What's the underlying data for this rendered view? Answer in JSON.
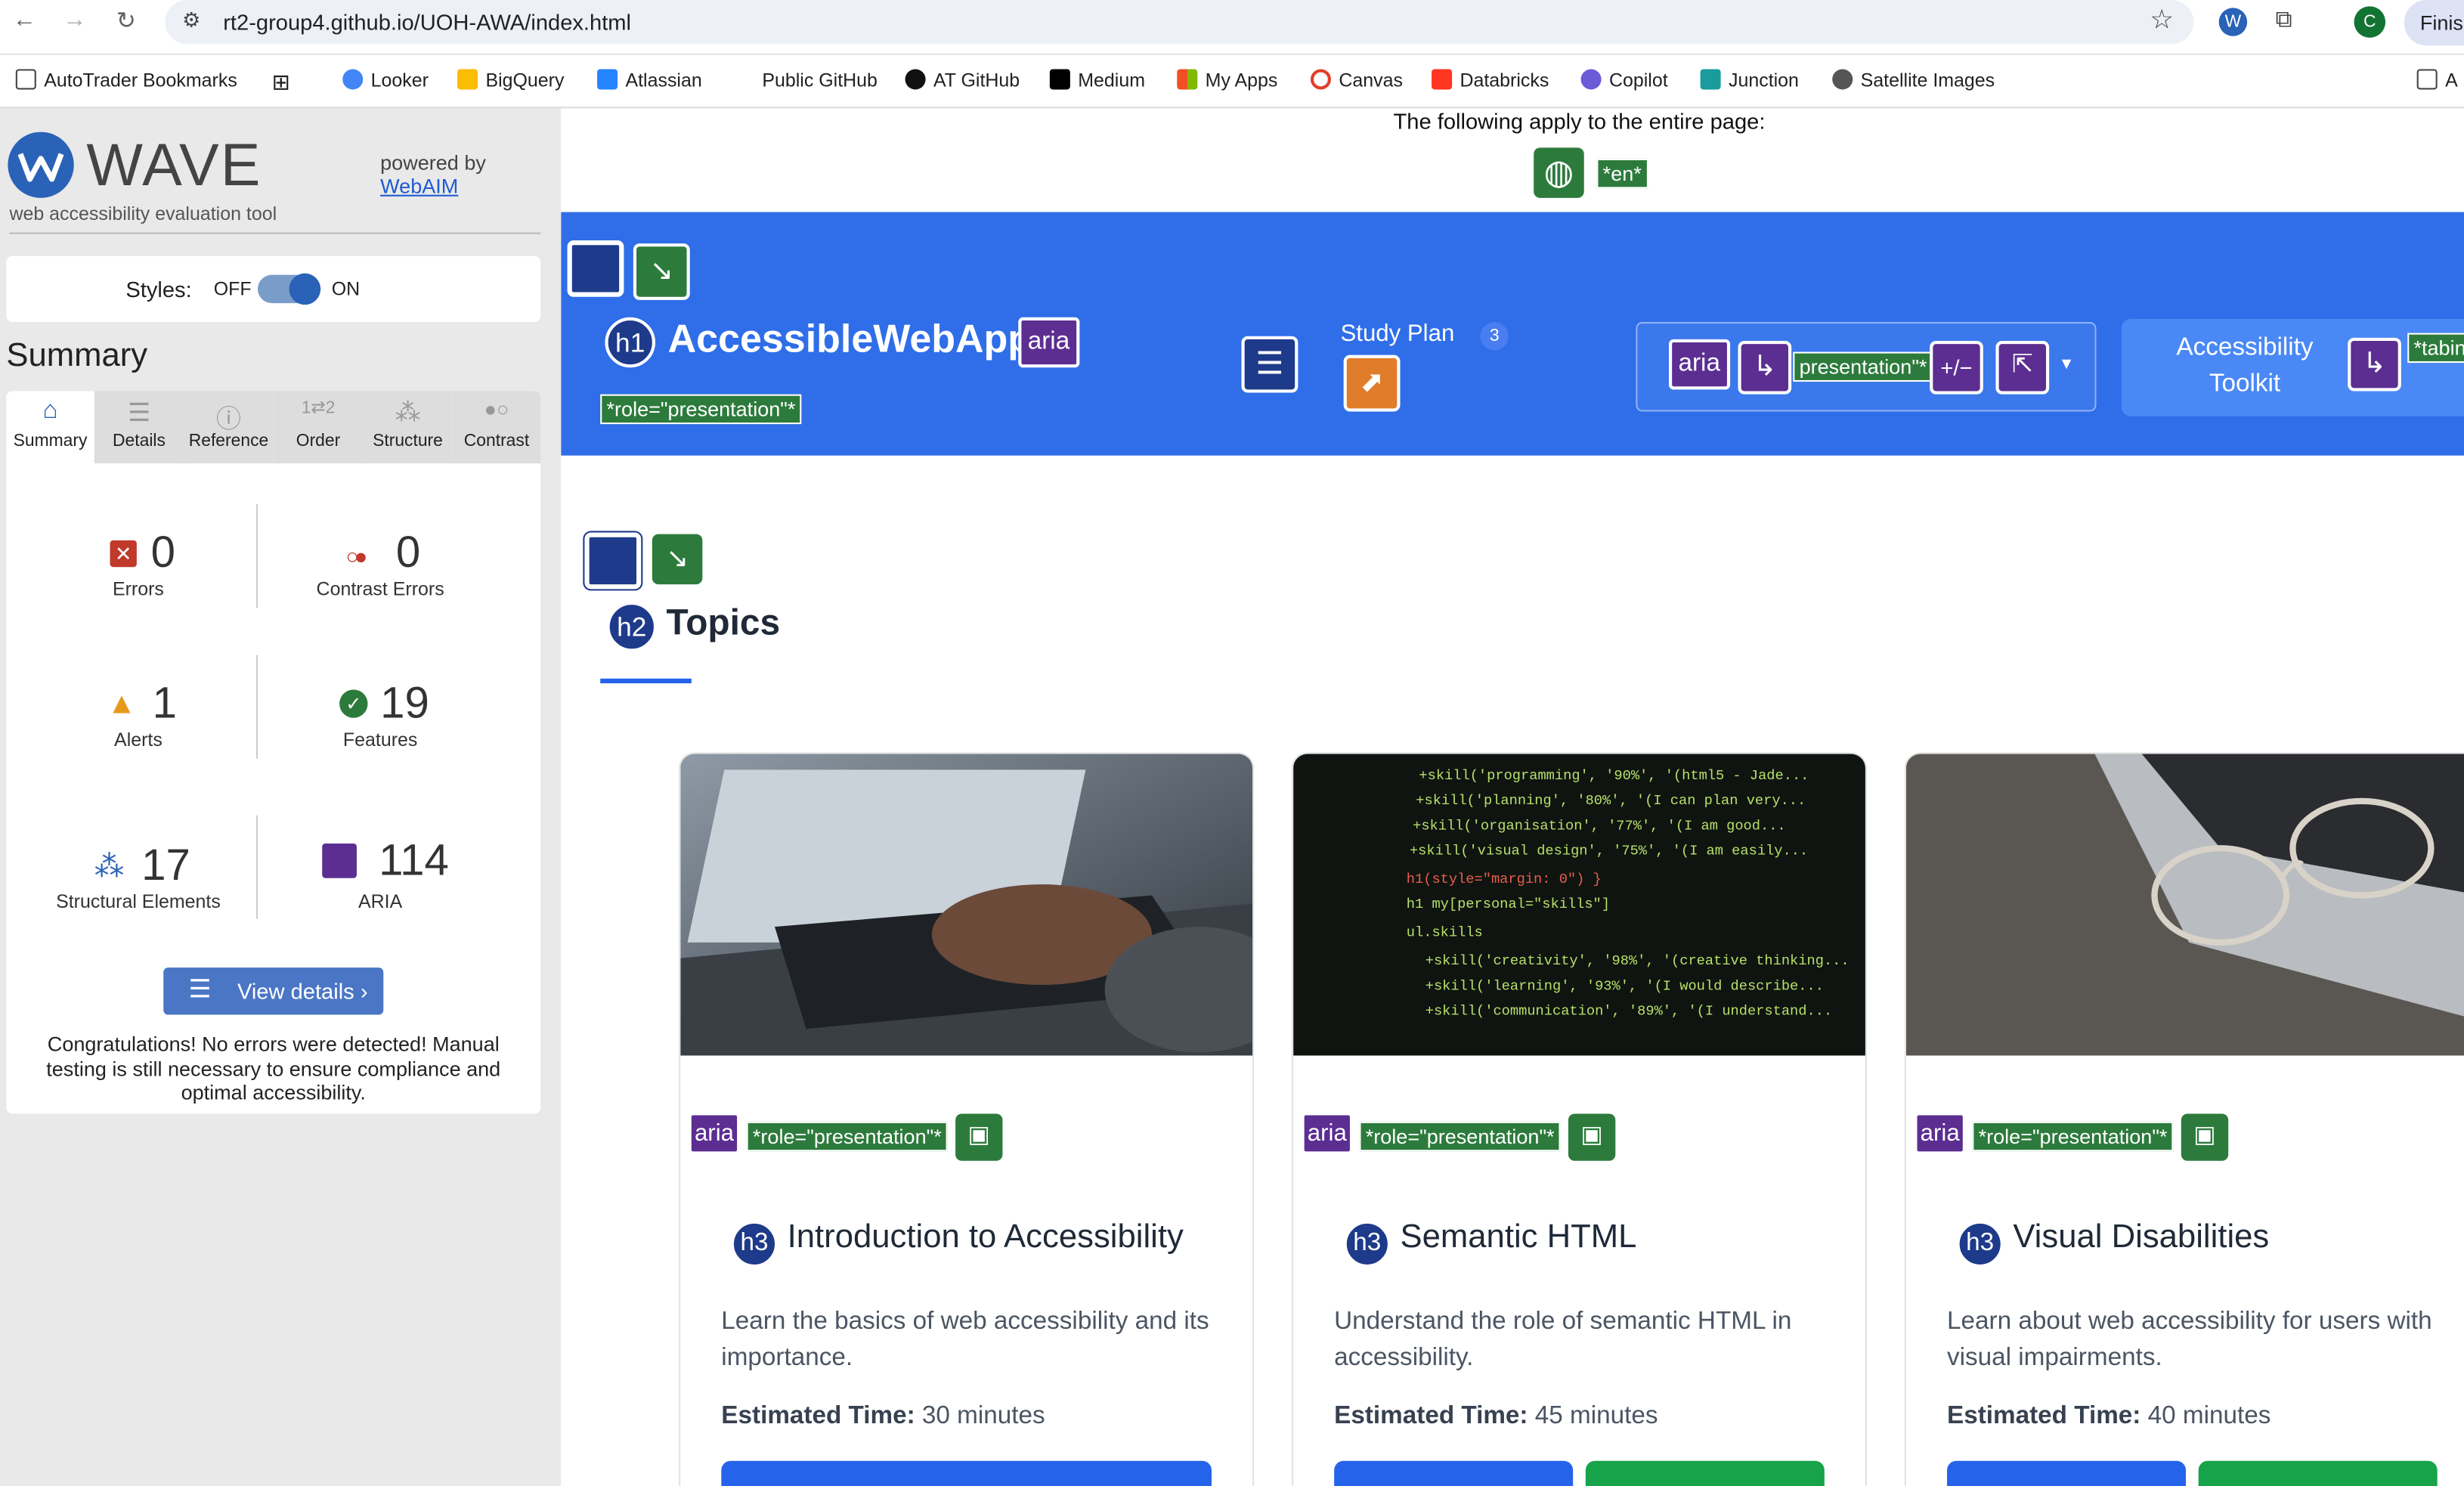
{
  "browser": {
    "url": "rt2-group4.github.io/UOH-AWA/index.html",
    "profile_initial": "C",
    "finish_label": "Finis",
    "bookmarks": [
      "AutoTrader Bookmarks",
      "Looker",
      "BigQuery",
      "Atlassian",
      "Public GitHub",
      "AT GitHub",
      "Medium",
      "My Apps",
      "Canvas",
      "Databricks",
      "Copilot",
      "Junction",
      "Satellite Images"
    ],
    "bookmark_overflow": "A"
  },
  "wave": {
    "logo_text": "WAVE",
    "tagline": "web accessibility evaluation tool",
    "powered_by": "powered by",
    "webaim": "WebAIM",
    "styles_label": "Styles:",
    "off": "OFF",
    "on": "ON",
    "summary_heading": "Summary",
    "tabs": [
      {
        "label": "Summary",
        "icon": "home-icon"
      },
      {
        "label": "Details",
        "icon": "list-icon"
      },
      {
        "label": "Reference",
        "icon": "info-icon"
      },
      {
        "label": "Order",
        "icon": "order-icon"
      },
      {
        "label": "Structure",
        "icon": "structure-icon"
      },
      {
        "label": "Contrast",
        "icon": "contrast-icon"
      }
    ],
    "stats": {
      "errors": {
        "value": "0",
        "label": "Errors"
      },
      "contrast": {
        "value": "0",
        "label": "Contrast Errors"
      },
      "alerts": {
        "value": "1",
        "label": "Alerts"
      },
      "features": {
        "value": "19",
        "label": "Features"
      },
      "structural": {
        "value": "17",
        "label": "Structural Elements"
      },
      "aria": {
        "value": "114",
        "label": "ARIA"
      }
    },
    "view_details": "View details ›",
    "congrats": "Congratulations! No errors were detected! Manual testing is still necessary to ensure compliance and optimal accessibility."
  },
  "page": {
    "entire_page_note": "The following apply to the entire page:",
    "lang_tag": "*en*",
    "brand": "AccessibleWebApp",
    "aria": "aria",
    "h1": "h1",
    "h2": "h2",
    "h3": "h3",
    "role_presentation": "*role=\"presentation\"*",
    "presentation_short": "presentation\"*",
    "study_plan": "Study Plan",
    "study_count": "3",
    "plus_minus": "+/−",
    "toolkit_line1": "Accessibility",
    "toolkit_line2": "Toolkit",
    "tabindex_tag": "*tabin",
    "topics_heading": "Topics",
    "cards": [
      {
        "title": "Introduction to Accessibility",
        "desc": "Learn the basics of web accessibility and its importance.",
        "time_label": "Estimated Time:",
        "time": "30 minutes"
      },
      {
        "title": "Semantic HTML",
        "desc": "Understand the role of semantic HTML in accessibility.",
        "time_label": "Estimated Time:",
        "time": "45 minutes"
      },
      {
        "title": "Visual Disabilities",
        "desc": "Learn about web accessibility for users with visual impairments.",
        "time_label": "Estimated Time:",
        "time": "40 minutes"
      }
    ]
  },
  "colors": {
    "hero": "#2f6ee8",
    "wave_blue": "#2962b7",
    "aria_purple": "#5c2e91",
    "role_green": "#2d7b3c"
  }
}
